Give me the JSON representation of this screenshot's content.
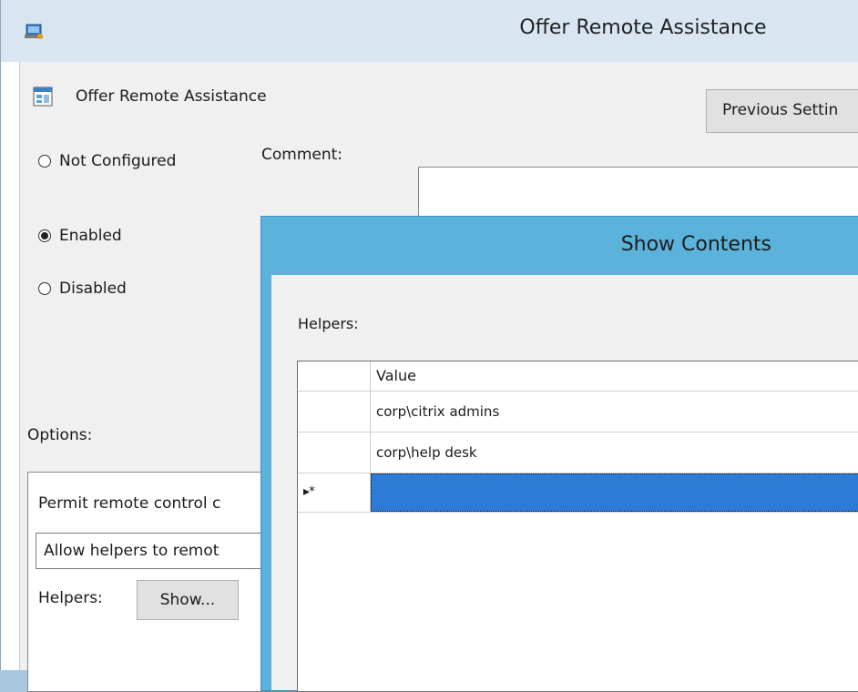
{
  "main_window": {
    "title": "Offer Remote Assistance",
    "policy_name": "Offer Remote Assistance",
    "previous_setting_button": "Previous Settin",
    "radios": [
      {
        "label": "Not Configured",
        "selected": false
      },
      {
        "label": "Enabled",
        "selected": true
      },
      {
        "label": "Disabled",
        "selected": false
      }
    ],
    "comment_label": "Comment:",
    "options_label": "Options:",
    "options": {
      "permit_text": "Permit remote control c",
      "allow_select_value": "Allow helpers to remot",
      "helpers_label": "Helpers:",
      "show_button": "Show..."
    }
  },
  "dialog": {
    "title": "Show Contents",
    "helpers_label": "Helpers:",
    "grid": {
      "column_header": "Value",
      "rows": [
        "corp\\citrix admins",
        "corp\\help desk"
      ],
      "new_row_indicator": "▸*"
    }
  },
  "colors": {
    "dialog_frame": "#5bb3dc",
    "selection": "#2e7bd7",
    "main_titlebar": "#d9e6f1"
  }
}
